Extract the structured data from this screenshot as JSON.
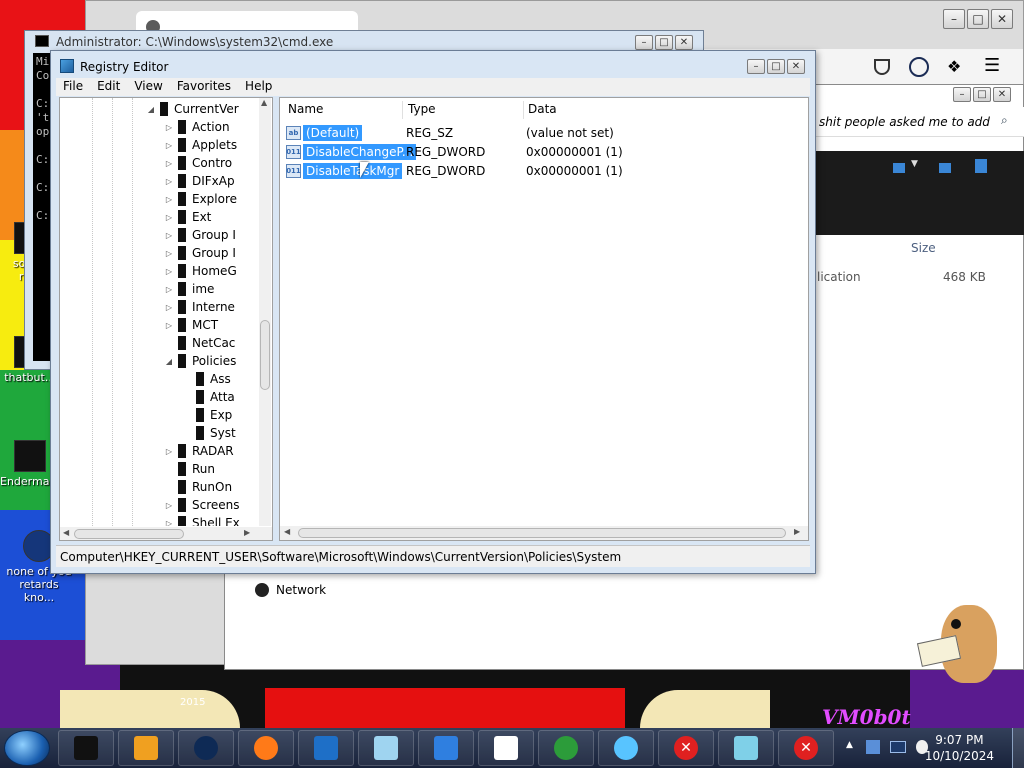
{
  "desktop": {
    "icons": [
      {
        "label": "som…\nra…"
      },
      {
        "label": "thatbut…"
      },
      {
        "label": "Enderma…"
      },
      {
        "label": "none of you retards kno..."
      }
    ],
    "wallpaper_text": [
      {
        "text": "2015"
      },
      {
        "text": "VM0b0t"
      }
    ]
  },
  "browser": {
    "tab_title": "",
    "search_text": "shit people asked me to add"
  },
  "explorer": {
    "column_size": "Size",
    "file_type_partial": "lication",
    "file_size": "468 KB",
    "nav_network": "Network"
  },
  "cmd": {
    "title": "Administrator: C:\\Windows\\system32\\cmd.exe",
    "lines": [
      "Mi",
      "Co",
      "",
      "C:",
      "'t",
      "op",
      "",
      "C:",
      "",
      "C:",
      "",
      "C:"
    ]
  },
  "regedit": {
    "title": "Registry Editor",
    "menu": [
      "File",
      "Edit",
      "View",
      "Favorites",
      "Help"
    ],
    "tree": [
      {
        "label": "CurrentVer",
        "level": 0,
        "expander": "open"
      },
      {
        "label": "Action",
        "level": 1,
        "expander": "closed"
      },
      {
        "label": "Applets",
        "level": 1,
        "expander": "closed"
      },
      {
        "label": "Contro",
        "level": 1,
        "expander": "closed"
      },
      {
        "label": "DIFxAp",
        "level": 1,
        "expander": "closed"
      },
      {
        "label": "Explore",
        "level": 1,
        "expander": "closed"
      },
      {
        "label": "Ext",
        "level": 1,
        "expander": "closed"
      },
      {
        "label": "Group I",
        "level": 1,
        "expander": "closed"
      },
      {
        "label": "Group I",
        "level": 1,
        "expander": "closed"
      },
      {
        "label": "HomeG",
        "level": 1,
        "expander": "closed"
      },
      {
        "label": "ime",
        "level": 1,
        "expander": "closed"
      },
      {
        "label": "Interne",
        "level": 1,
        "expander": "closed"
      },
      {
        "label": "MCT",
        "level": 1,
        "expander": "closed"
      },
      {
        "label": "NetCac",
        "level": 1,
        "expander": "none"
      },
      {
        "label": "Policies",
        "level": 1,
        "expander": "open"
      },
      {
        "label": "Ass",
        "level": 2,
        "expander": "none"
      },
      {
        "label": "Atta",
        "level": 2,
        "expander": "none"
      },
      {
        "label": "Exp",
        "level": 2,
        "expander": "none"
      },
      {
        "label": "Syst",
        "level": 2,
        "expander": "none"
      },
      {
        "label": "RADAR",
        "level": 1,
        "expander": "closed"
      },
      {
        "label": "Run",
        "level": 1,
        "expander": "none"
      },
      {
        "label": "RunOn",
        "level": 1,
        "expander": "none"
      },
      {
        "label": "Screens",
        "level": 1,
        "expander": "closed"
      },
      {
        "label": "Shell Ex",
        "level": 1,
        "expander": "closed"
      }
    ],
    "columns": {
      "name": "Name",
      "type": "Type",
      "data": "Data"
    },
    "values": [
      {
        "icon": "ab",
        "name": "(Default)",
        "type": "REG_SZ",
        "data": "(value not set)"
      },
      {
        "icon": "011",
        "name": "DisableChangeP...",
        "type": "REG_DWORD",
        "data": "0x00000001 (1)"
      },
      {
        "icon": "011",
        "name": "DisableTaskMgr",
        "type": "REG_DWORD",
        "data": "0x00000001 (1)"
      }
    ],
    "status_path": "Computer\\HKEY_CURRENT_USER\\Software\\Microsoft\\Windows\\CurrentVersion\\Policies\\System"
  },
  "taskbar": {
    "time": "9:07 PM",
    "date": "10/10/2024",
    "apps": [
      "black-window-icon",
      "media-player-icon",
      "dark-globe-icon",
      "firefox-icon",
      "monitor-icon",
      "notepad-icon",
      "blue-app-icon",
      "checklist-icon",
      "globe-arrow-icon",
      "ring-icon",
      "error-icon",
      "cubes-icon",
      "error-icon"
    ]
  }
}
